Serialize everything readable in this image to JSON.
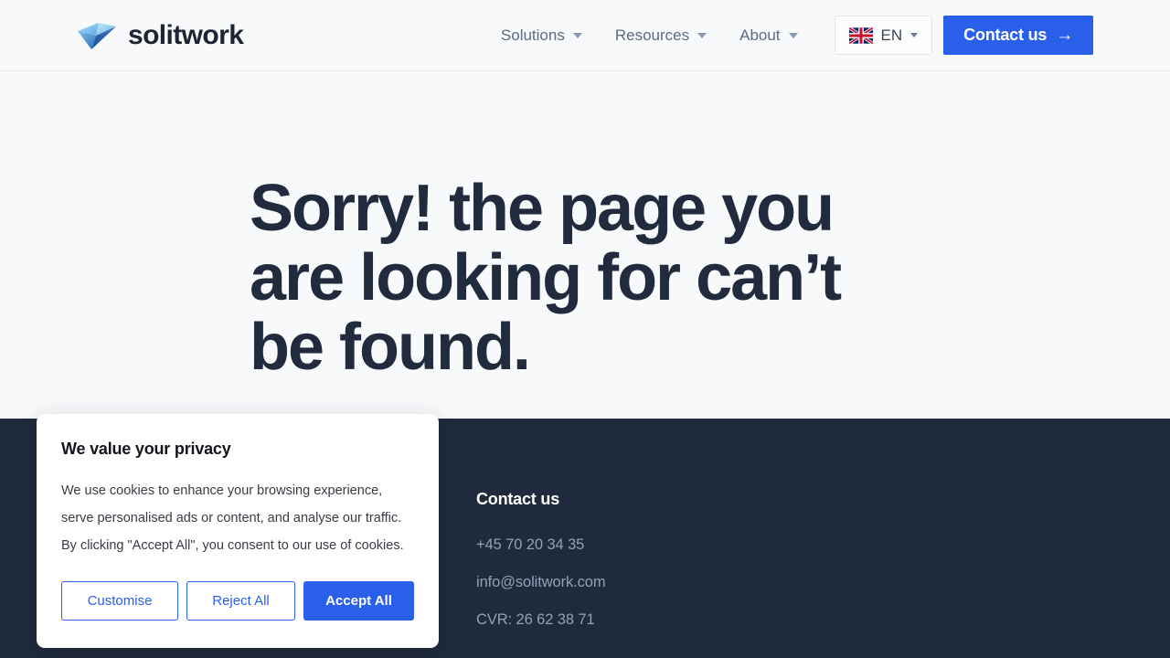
{
  "brand": {
    "name": "solitwork",
    "logo_icon": "paper-plane-logo",
    "logo_colors": [
      "#8fd3f4",
      "#4a90d9",
      "#2f6fb5",
      "#1d4e8f"
    ]
  },
  "header": {
    "nav": [
      {
        "label": "Solutions",
        "icon": "chevron-down-icon"
      },
      {
        "label": "Resources",
        "icon": "chevron-down-icon"
      },
      {
        "label": "About",
        "icon": "chevron-down-icon"
      }
    ],
    "language": {
      "code": "EN",
      "flag_icon": "uk-flag-icon",
      "caret_icon": "chevron-down-icon"
    },
    "cta": {
      "label": "Contact us",
      "arrow": "→",
      "color": "#2a5fea"
    }
  },
  "hero": {
    "title": "Sorry! the page you are looking for can’t be found.",
    "title_color": "#212b3d"
  },
  "footer": {
    "background": "#1f2a3c",
    "contact": {
      "title": "Contact us",
      "phone": "+45 70 20 34 35",
      "email": "info@solitwork.com",
      "cvr": "CVR: 26 62 38 71"
    }
  },
  "cookie_banner": {
    "title": "We value your privacy",
    "body": "We use cookies to enhance your browsing experience, serve personalised ads or content, and analyse our traffic. By clicking \"Accept All\", you consent to our use of cookies.",
    "buttons": {
      "customise": "Customise",
      "reject": "Reject All",
      "accept": "Accept All"
    },
    "accent_color": "#2a5fea"
  }
}
